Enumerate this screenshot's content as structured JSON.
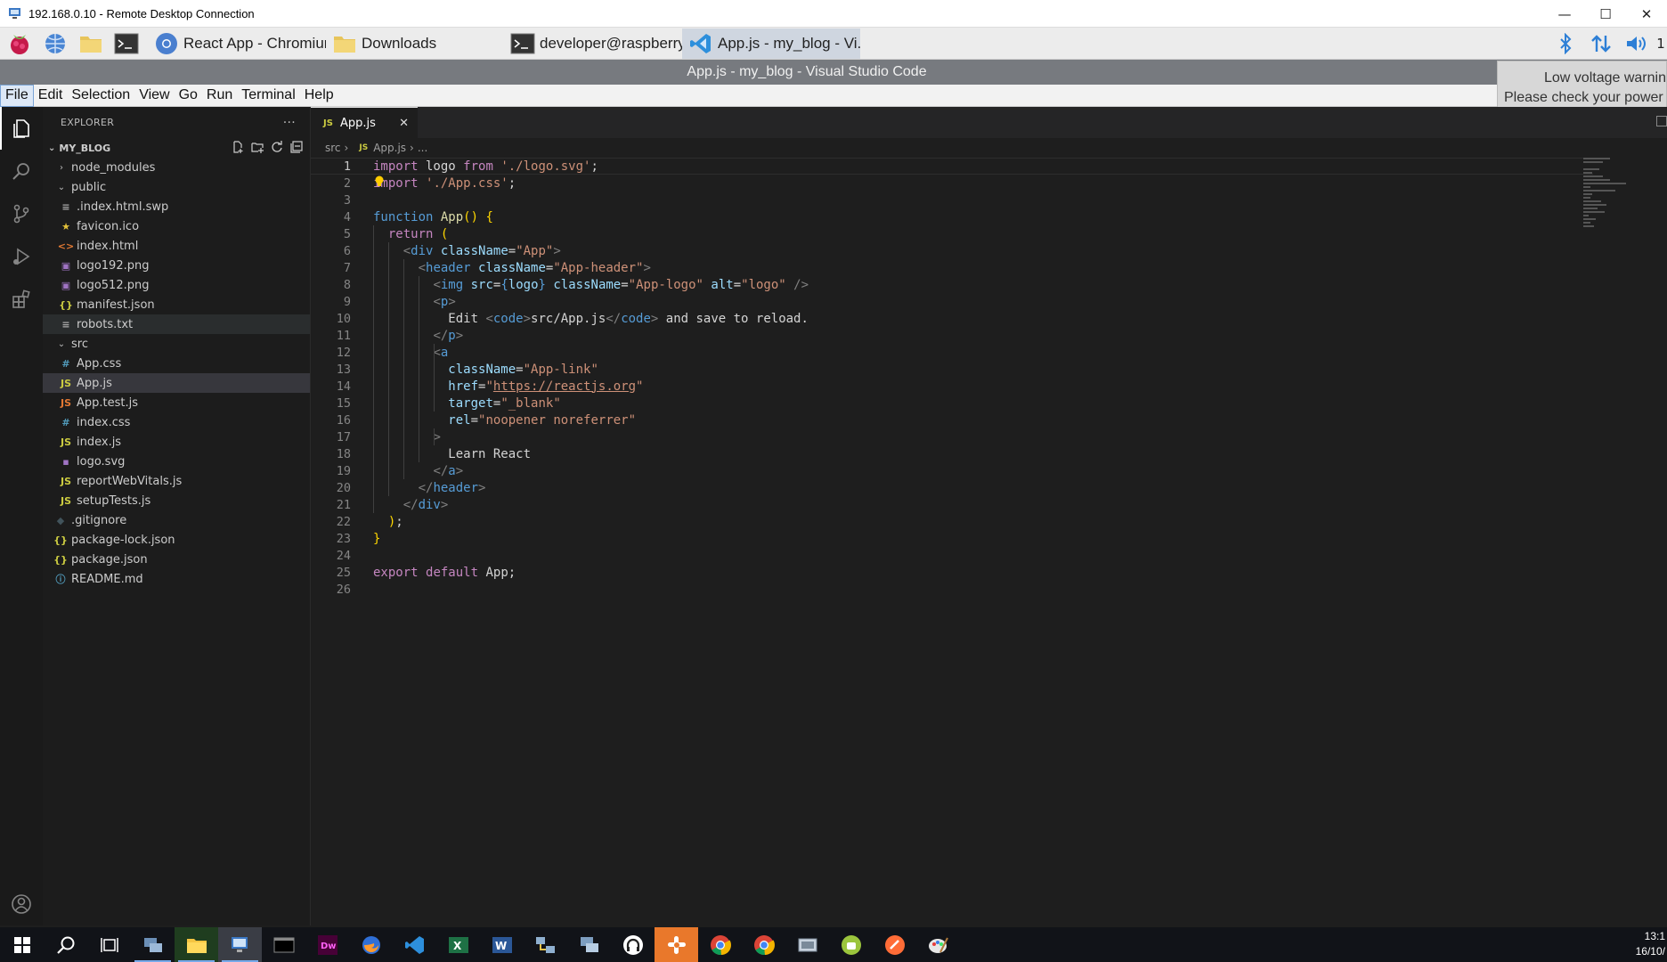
{
  "rdp": {
    "title": "192.168.0.10 - Remote Desktop Connection",
    "controls": [
      "—",
      "☐",
      "✕"
    ]
  },
  "pi_taskbar": {
    "tasks": [
      {
        "label": "React App - Chromium",
        "icon": "chromium-icon"
      },
      {
        "label": "Downloads",
        "icon": "folder-icon"
      },
      {
        "label": "developer@raspberry...",
        "icon": "terminal-icon"
      },
      {
        "label": "App.js - my_blog - Vi...",
        "icon": "vscode-icon"
      }
    ],
    "tray_clock": "1"
  },
  "vscode": {
    "window_title": "App.js - my_blog - Visual Studio Code",
    "menu": [
      "File",
      "Edit",
      "Selection",
      "View",
      "Go",
      "Run",
      "Terminal",
      "Help"
    ]
  },
  "notification": {
    "line1": "Low voltage warning",
    "line2": "Please check your power s"
  },
  "sidebar": {
    "title": "EXPLORER",
    "more": "···",
    "folder": "MY_BLOG",
    "tree": [
      {
        "label": "node_modules",
        "depth": 1,
        "type": "folder",
        "open": false
      },
      {
        "label": "public",
        "depth": 1,
        "type": "folder",
        "open": true
      },
      {
        "label": ".index.html.swp",
        "depth": 2,
        "type": "swp"
      },
      {
        "label": "favicon.ico",
        "depth": 2,
        "type": "ico"
      },
      {
        "label": "index.html",
        "depth": 2,
        "type": "html"
      },
      {
        "label": "logo192.png",
        "depth": 2,
        "type": "img"
      },
      {
        "label": "logo512.png",
        "depth": 2,
        "type": "img"
      },
      {
        "label": "manifest.json",
        "depth": 2,
        "type": "json"
      },
      {
        "label": "robots.txt",
        "depth": 2,
        "type": "txt",
        "hover": true
      },
      {
        "label": "src",
        "depth": 1,
        "type": "folder",
        "open": true
      },
      {
        "label": "App.css",
        "depth": 2,
        "type": "css"
      },
      {
        "label": "App.js",
        "depth": 2,
        "type": "js",
        "selected": true
      },
      {
        "label": "App.test.js",
        "depth": 2,
        "type": "test"
      },
      {
        "label": "index.css",
        "depth": 2,
        "type": "css"
      },
      {
        "label": "index.js",
        "depth": 2,
        "type": "js"
      },
      {
        "label": "logo.svg",
        "depth": 2,
        "type": "svg"
      },
      {
        "label": "reportWebVitals.js",
        "depth": 2,
        "type": "js"
      },
      {
        "label": "setupTests.js",
        "depth": 2,
        "type": "js"
      },
      {
        "label": ".gitignore",
        "depth": 1,
        "type": "git"
      },
      {
        "label": "package-lock.json",
        "depth": 1,
        "type": "json"
      },
      {
        "label": "package.json",
        "depth": 1,
        "type": "json"
      },
      {
        "label": "README.md",
        "depth": 1,
        "type": "md"
      }
    ]
  },
  "editor": {
    "tab_label": "App.js",
    "tab_lang": "JS",
    "breadcrumb": {
      "folder": "src",
      "file": "App.js",
      "more": "..."
    },
    "lines": [
      [
        [
          "k1",
          "import"
        ],
        [
          "t",
          " logo "
        ],
        [
          "k1",
          "from"
        ],
        [
          "t",
          " "
        ],
        [
          "s",
          "'./logo.svg'"
        ],
        [
          "t",
          ";"
        ]
      ],
      [
        [
          "k1",
          "import"
        ],
        [
          "t",
          " "
        ],
        [
          "s",
          "'./App.css'"
        ],
        [
          "t",
          ";"
        ]
      ],
      [],
      [
        [
          "k2",
          "function"
        ],
        [
          "t",
          " "
        ],
        [
          "fn",
          "App"
        ],
        [
          "br",
          "()"
        ],
        [
          "t",
          " "
        ],
        [
          "br",
          "{"
        ]
      ],
      [
        [
          "t",
          "  "
        ],
        [
          "k1",
          "return"
        ],
        [
          "t",
          " "
        ],
        [
          "br",
          "("
        ]
      ],
      [
        [
          "t",
          "    "
        ],
        [
          "ang",
          "<"
        ],
        [
          "tg",
          "div"
        ],
        [
          "t",
          " "
        ],
        [
          "v",
          "className"
        ],
        [
          "t",
          "="
        ],
        [
          "s",
          "\"App\""
        ],
        [
          "ang",
          ">"
        ]
      ],
      [
        [
          "t",
          "      "
        ],
        [
          "ang",
          "<"
        ],
        [
          "tg",
          "header"
        ],
        [
          "t",
          " "
        ],
        [
          "v",
          "className"
        ],
        [
          "t",
          "="
        ],
        [
          "s",
          "\"App-header\""
        ],
        [
          "ang",
          ">"
        ]
      ],
      [
        [
          "t",
          "        "
        ],
        [
          "ang",
          "<"
        ],
        [
          "tg",
          "img"
        ],
        [
          "t",
          " "
        ],
        [
          "v",
          "src"
        ],
        [
          "t",
          "="
        ],
        [
          "k2",
          "{"
        ],
        [
          "v",
          "logo"
        ],
        [
          "k2",
          "}"
        ],
        [
          "t",
          " "
        ],
        [
          "v",
          "className"
        ],
        [
          "t",
          "="
        ],
        [
          "s",
          "\"App-logo\""
        ],
        [
          "t",
          " "
        ],
        [
          "v",
          "alt"
        ],
        [
          "t",
          "="
        ],
        [
          "s",
          "\"logo\""
        ],
        [
          "t",
          " "
        ],
        [
          "ang",
          "/>"
        ]
      ],
      [
        [
          "t",
          "        "
        ],
        [
          "ang",
          "<"
        ],
        [
          "tg",
          "p"
        ],
        [
          "ang",
          ">"
        ]
      ],
      [
        [
          "t",
          "          Edit "
        ],
        [
          "ang",
          "<"
        ],
        [
          "tg",
          "code"
        ],
        [
          "ang",
          ">"
        ],
        [
          "t",
          "src/App.js"
        ],
        [
          "ang",
          "</"
        ],
        [
          "tg",
          "code"
        ],
        [
          "ang",
          ">"
        ],
        [
          "t",
          " and save to reload."
        ]
      ],
      [
        [
          "t",
          "        "
        ],
        [
          "ang",
          "</"
        ],
        [
          "tg",
          "p"
        ],
        [
          "ang",
          ">"
        ]
      ],
      [
        [
          "t",
          "        "
        ],
        [
          "ang",
          "<"
        ],
        [
          "tg",
          "a"
        ]
      ],
      [
        [
          "t",
          "          "
        ],
        [
          "v",
          "className"
        ],
        [
          "t",
          "="
        ],
        [
          "s",
          "\"App-link\""
        ]
      ],
      [
        [
          "t",
          "          "
        ],
        [
          "v",
          "href"
        ],
        [
          "t",
          "="
        ],
        [
          "s",
          "\""
        ],
        [
          "link",
          "https://reactjs.org"
        ],
        [
          "s",
          "\""
        ]
      ],
      [
        [
          "t",
          "          "
        ],
        [
          "v",
          "target"
        ],
        [
          "t",
          "="
        ],
        [
          "s",
          "\"_blank\""
        ]
      ],
      [
        [
          "t",
          "          "
        ],
        [
          "v",
          "rel"
        ],
        [
          "t",
          "="
        ],
        [
          "s",
          "\"noopener noreferrer\""
        ]
      ],
      [
        [
          "t",
          "        "
        ],
        [
          "ang",
          ">"
        ]
      ],
      [
        [
          "t",
          "          Learn React"
        ]
      ],
      [
        [
          "t",
          "        "
        ],
        [
          "ang",
          "</"
        ],
        [
          "tg",
          "a"
        ],
        [
          "ang",
          ">"
        ]
      ],
      [
        [
          "t",
          "      "
        ],
        [
          "ang",
          "</"
        ],
        [
          "tg",
          "header"
        ],
        [
          "ang",
          ">"
        ]
      ],
      [
        [
          "t",
          "    "
        ],
        [
          "ang",
          "</"
        ],
        [
          "tg",
          "div"
        ],
        [
          "ang",
          ">"
        ]
      ],
      [
        [
          "t",
          "  "
        ],
        [
          "br",
          ")"
        ],
        [
          "t",
          ";"
        ]
      ],
      [
        [
          "br",
          "}"
        ]
      ],
      [],
      [
        [
          "k1",
          "export"
        ],
        [
          "t",
          " "
        ],
        [
          "k1",
          "default"
        ],
        [
          "t",
          " App;"
        ]
      ],
      []
    ]
  },
  "clock": {
    "time": "13:1",
    "date": "16/10/"
  }
}
